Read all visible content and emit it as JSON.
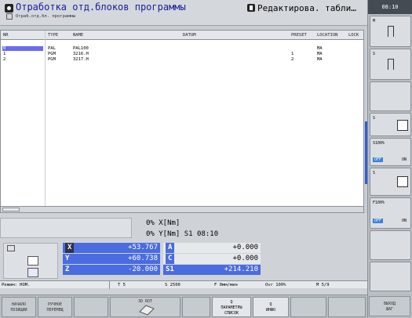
{
  "header": {
    "title": "Отработка отд.блоков программы",
    "subtitle": "Отраб.отд.бл. программы",
    "mode_right": "Редактирова. табли…"
  },
  "clock": "08:10",
  "table": {
    "columns": [
      "NR",
      "TYPE",
      "NAME",
      "DATUM",
      "PRESET",
      "LOCATION",
      "LOCK"
    ],
    "rows": [
      {
        "nr": "0",
        "type": "PAL",
        "name": "PAL100",
        "datum": "",
        "preset": "",
        "location": "MA",
        "lock": ""
      },
      {
        "nr": "1",
        "type": "PGM",
        "name": "3216.H",
        "datum": "",
        "preset": "1",
        "location": "MA",
        "lock": ""
      },
      {
        "nr": "2",
        "type": "PGM",
        "name": "3217.H",
        "datum": "",
        "preset": "2",
        "location": "MA",
        "lock": ""
      }
    ]
  },
  "status_lines": {
    "line1": "0% X[Nm]",
    "line2": "0% Y[Nm] S1   08:10"
  },
  "axes": [
    {
      "axis": "X",
      "value": "+53.767"
    },
    {
      "axis": "Y",
      "value": "+60.738"
    },
    {
      "axis": "Z",
      "value": "-20.000"
    },
    {
      "axis": "A",
      "value": "+0.000"
    },
    {
      "axis": "C",
      "value": "+0.000"
    },
    {
      "axis": "S1",
      "value": "+214.210"
    }
  ],
  "statusbar": {
    "mode": "Режим: НОМ.",
    "tool": "T 5",
    "spindle": "S 2500",
    "feed": "F 0мм/мин",
    "ovr": "Ovr 100%",
    "m": "M 5/9"
  },
  "right_softkeys": {
    "m_label": "M",
    "s_label": "S",
    "s_label2": "S",
    "s100": "S100%",
    "off1": "OFF",
    "on1": "ON",
    "s_label3": "S",
    "f100": "F100%",
    "off2": "OFF",
    "on2": "ON"
  },
  "bottom_softkeys": [
    {
      "lines": [
        "НАЧАЛО",
        "ПОЗИЦИИ"
      ],
      "active": false
    },
    {
      "lines": [
        "РУЧНОЕ",
        "ПЕРЕМЕЩ"
      ],
      "active": false
    },
    {
      "lines": [
        "3D ROT"
      ],
      "active": false
    },
    {
      "lines": [
        ""
      ],
      "active": false
    },
    {
      "lines": [
        ""
      ],
      "active": false
    },
    {
      "lines": [
        "Q",
        "ПАРАМЕТРЫ",
        "СПИСОК"
      ],
      "active": true
    },
    {
      "lines": [
        "Q",
        "ИНФО"
      ],
      "active": true
    },
    {
      "lines": [
        ""
      ],
      "active": false
    },
    {
      "lines": [
        ""
      ],
      "active": false
    },
    {
      "lines": [
        "ВЫХОД",
        "ШАГ"
      ],
      "active": false
    }
  ]
}
